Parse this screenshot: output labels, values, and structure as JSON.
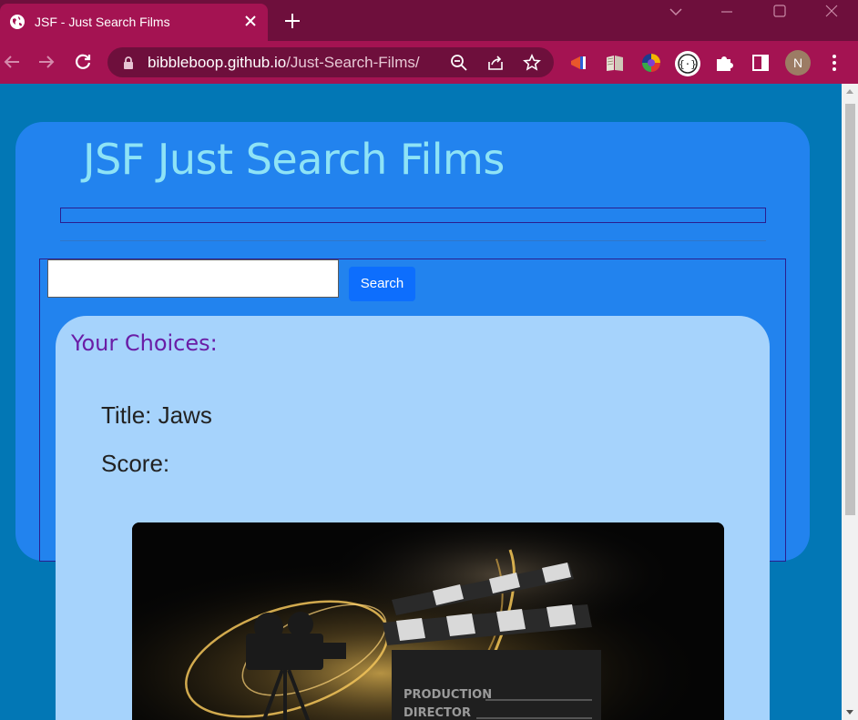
{
  "browser": {
    "tab_title": "JSF - Just Search Films",
    "url_host": "bibbleboop.github.io",
    "url_path": "/Just-Search-Films/",
    "profile_initial": "N",
    "colors": {
      "frame": "#6e0f3c",
      "toolbar": "#a41352"
    }
  },
  "page": {
    "site_title": "JSF Just Search Films",
    "search": {
      "button_label": "Search",
      "value": "",
      "placeholder": ""
    },
    "choices": {
      "heading": "Your Choices:",
      "title_line": "Title: Jaws",
      "score_line": "Score:"
    },
    "image_text": {
      "line1": "PRODUCTION",
      "line2": "DIRECTOR"
    },
    "colors": {
      "background": "#0277b5",
      "hero": "#2283ee",
      "card": "#a6d3fc",
      "heading": "#6a1da6",
      "title": "#8ee3f6",
      "button": "#0d6efd"
    }
  },
  "icons": [
    "globe-icon",
    "close-icon",
    "plus-icon",
    "chevron-down-icon",
    "minimize-icon",
    "maximize-icon",
    "window-close-icon",
    "back-arrow-icon",
    "forward-arrow-icon",
    "reload-icon",
    "lock-icon",
    "zoom-out-icon",
    "share-icon",
    "star-icon",
    "megaphone-icon",
    "book-icon",
    "color-wheel-icon",
    "braces-icon",
    "puzzle-icon",
    "sidepanel-icon",
    "kebab-menu-icon"
  ]
}
